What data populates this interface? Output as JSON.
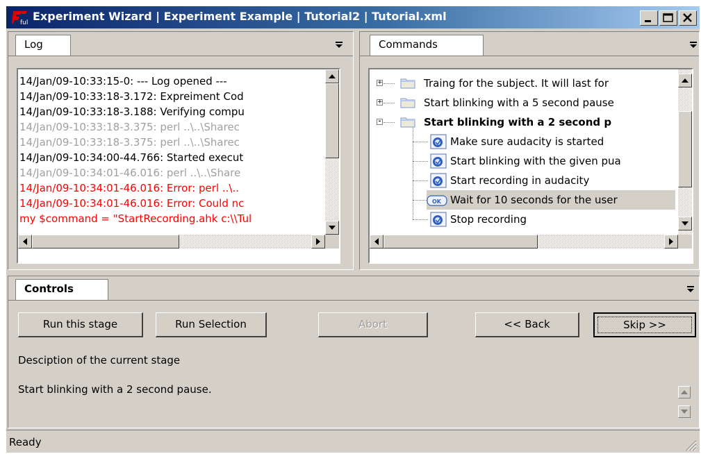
{
  "window": {
    "title": "Experiment Wizard | Experiment Example | Tutorial2 | Tutorial.xml",
    "buttons": [
      "minimize-icon",
      "maximize-icon",
      "close-icon"
    ]
  },
  "log_pane": {
    "tab_label": "Log",
    "lines": [
      {
        "text": "14/Jan/09-10:33:15-0: --- Log opened ---",
        "style": "normal"
      },
      {
        "text": "14/Jan/09-10:33:18-3.172: Expreiment Cod",
        "style": "normal"
      },
      {
        "text": "14/Jan/09-10:33:18-3.188: Verifying compu",
        "style": "normal"
      },
      {
        "text": "14/Jan/09-10:33:18-3.375: perl ..\\..\\Sharec",
        "style": "gray"
      },
      {
        "text": "14/Jan/09-10:33:18-3.375: perl ..\\..\\Sharec",
        "style": "gray"
      },
      {
        "text": "14/Jan/09-10:34:00-44.766: Started execut",
        "style": "normal"
      },
      {
        "text": "14/Jan/09-10:34:01-46.016: perl ..\\..\\Share",
        "style": "gray"
      },
      {
        "text": "14/Jan/09-10:34:01-46.016: Error: perl ..\\..",
        "style": "error"
      },
      {
        "text": "14/Jan/09-10:34:01-46.016: Error: Could nc",
        "style": "error"
      },
      {
        "text": "my $command = \"StartRecording.ahk c:\\\\Tul",
        "style": "error"
      }
    ]
  },
  "commands_pane": {
    "tab_label": "Commands",
    "items": [
      {
        "label": "Traing for the subject. It will last for",
        "level": 0,
        "icon": "folder-icon",
        "expander": "+"
      },
      {
        "label": "Start blinking with a 5 second pause",
        "level": 0,
        "icon": "folder-icon",
        "expander": "+"
      },
      {
        "label": "Start blinking with a 2 second p",
        "level": 0,
        "icon": "folder-icon",
        "expander": "-",
        "bold": true
      },
      {
        "label": "Make sure audacity is started",
        "level": 1,
        "icon": "script-icon"
      },
      {
        "label": "Start blinking with the given pua",
        "level": 1,
        "icon": "script-icon"
      },
      {
        "label": "Start recording in audacity",
        "level": 1,
        "icon": "script-icon"
      },
      {
        "label": "Wait for 10 seconds for the user",
        "level": 1,
        "icon": "ok-dialog-icon",
        "selected": true
      },
      {
        "label": "Stop recording",
        "level": 1,
        "icon": "script-icon"
      }
    ]
  },
  "controls_pane": {
    "tab_label": "Controls",
    "buttons": {
      "run_stage": "Run this stage",
      "run_selection": "Run Selection",
      "abort": "Abort",
      "back": "<< Back",
      "skip": "Skip >>"
    },
    "description_label": "Desciption of the current stage",
    "description_text": "Start blinking with a 2 second pause."
  },
  "status": {
    "text": "Ready"
  },
  "colors": {
    "error": "#ff0000",
    "gray": "#a0a0a0",
    "title_start": "#0a246a",
    "title_end": "#a6caf0"
  }
}
